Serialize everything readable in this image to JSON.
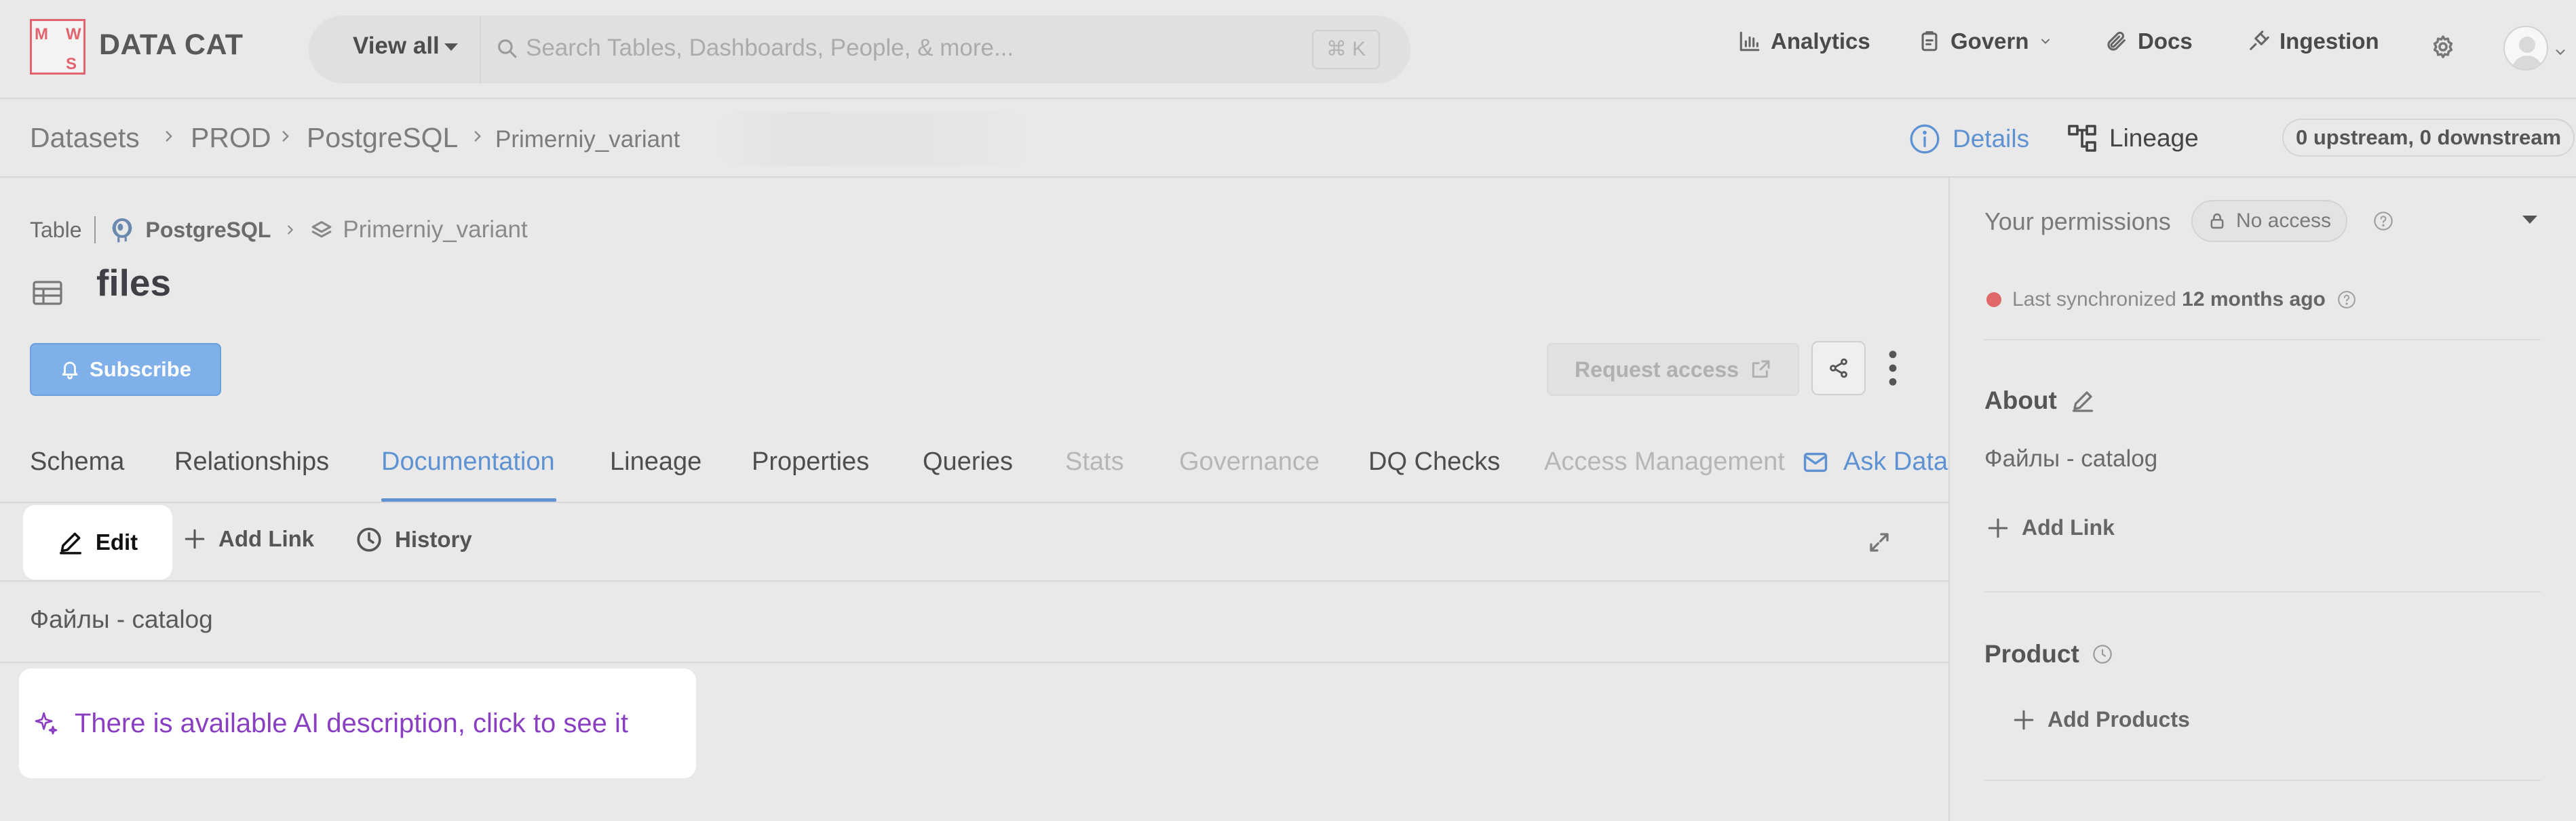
{
  "app": {
    "brand_name": "DATA CAT",
    "logo_letters": [
      "M",
      "W",
      "S"
    ],
    "logo_color": "#e0636d",
    "accent_color": "#5e92d2"
  },
  "search": {
    "scope_label": "View all",
    "placeholder": "Search Tables, Dashboards, People, & more...",
    "shortcut": "⌘ K"
  },
  "nav": {
    "analytics": "Analytics",
    "govern": "Govern",
    "docs": "Docs",
    "ingestion": "Ingestion"
  },
  "breadcrumb": [
    "Datasets",
    "PROD",
    "PostgreSQL",
    "Primerniy_variant"
  ],
  "view_tabs": {
    "details": "Details",
    "lineage": "Lineage",
    "upstream_downstream": "0 upstream, 0 downstream"
  },
  "entity": {
    "type": "Table",
    "platform": "PostgreSQL",
    "container": "Primerniy_variant",
    "title": "files"
  },
  "actions": {
    "subscribe": "Subscribe",
    "request_access": "Request access"
  },
  "tabs": [
    {
      "label": "Schema",
      "state": "normal"
    },
    {
      "label": "Relationships",
      "state": "normal"
    },
    {
      "label": "Documentation",
      "state": "active"
    },
    {
      "label": "Lineage",
      "state": "normal"
    },
    {
      "label": "Properties",
      "state": "normal"
    },
    {
      "label": "Queries",
      "state": "normal"
    },
    {
      "label": "Stats",
      "state": "disabled"
    },
    {
      "label": "Governance",
      "state": "disabled"
    },
    {
      "label": "DQ Checks",
      "state": "normal"
    },
    {
      "label": "Access Management",
      "state": "disabled"
    },
    {
      "label": "Ask Data",
      "state": "link"
    }
  ],
  "doc_toolbar": {
    "edit": "Edit",
    "add_link": "Add Link",
    "history": "History"
  },
  "documentation": {
    "text": "Файлы - catalog",
    "ai_hint": "There is available AI description, click to see it"
  },
  "sidebar": {
    "permissions_label": "Your permissions",
    "access_badge": "No access",
    "sync_prefix": "Last synchronized",
    "sync_time": "12 months ago",
    "sync_status_color": "#e06868",
    "about_title": "About",
    "about_text": "Файлы - catalog",
    "about_add_link": "Add Link",
    "product_title": "Product",
    "add_products": "Add Products"
  }
}
